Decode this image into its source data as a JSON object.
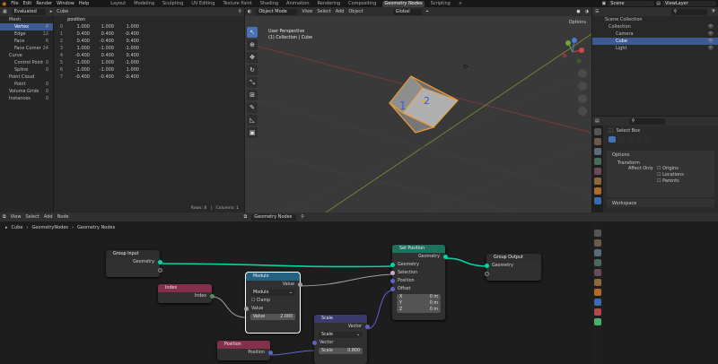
{
  "topbar": {
    "menus": [
      "File",
      "Edit",
      "Render",
      "Window",
      "Help"
    ],
    "workspaces": [
      "Layout",
      "Modeling",
      "Sculpting",
      "UV Editing",
      "Texture Paint",
      "Shading",
      "Animation",
      "Rendering",
      "Compositing",
      "Geometry Nodes",
      "Scripting"
    ],
    "active_workspace": "Geometry Nodes",
    "scene": "Scene",
    "view_layer": "ViewLayer"
  },
  "spreadsheet": {
    "mode": "Evaluated",
    "object": "Cube",
    "column_header": "position",
    "domains": [
      {
        "label": "Mesh",
        "level": 0
      },
      {
        "label": "Vertex",
        "level": 1,
        "count": "8",
        "selected": true
      },
      {
        "label": "Edge",
        "level": 1,
        "count": "12"
      },
      {
        "label": "Face",
        "level": 1,
        "count": "6"
      },
      {
        "label": "Face Corner",
        "level": 1,
        "count": "24"
      },
      {
        "label": "Curve",
        "level": 0
      },
      {
        "label": "Control Point",
        "level": 1,
        "count": "0"
      },
      {
        "label": "Spline",
        "level": 1,
        "count": "0"
      },
      {
        "label": "Point Cloud",
        "level": 0
      },
      {
        "label": "Point",
        "level": 1,
        "count": "0"
      },
      {
        "label": "Volume Grids",
        "level": 0,
        "count": "0"
      },
      {
        "label": "Instances",
        "level": 0,
        "count": "0"
      }
    ],
    "rows": [
      [
        "0",
        "1.000",
        "1.000",
        "1.000"
      ],
      [
        "1",
        "0.400",
        "0.400",
        "-0.400"
      ],
      [
        "2",
        "0.400",
        "-0.400",
        "0.400"
      ],
      [
        "3",
        "1.000",
        "-1.000",
        "-1.000"
      ],
      [
        "4",
        "-0.400",
        "0.400",
        "0.400"
      ],
      [
        "5",
        "-1.000",
        "1.000",
        "-1.000"
      ],
      [
        "6",
        "-1.000",
        "-1.000",
        "1.000"
      ],
      [
        "7",
        "-0.400",
        "-0.400",
        "-0.400"
      ]
    ],
    "footer_rows": "Rows: 8",
    "footer_cols": "Columns: 1"
  },
  "viewport": {
    "mode": "Object Mode",
    "menus": [
      "View",
      "Select",
      "Add",
      "Object"
    ],
    "transform": "Global",
    "info_line1": "User Perspective",
    "info_line2": "(1) Collection | Cube",
    "options": "Options"
  },
  "outliner": {
    "root": "Scene Collection",
    "items": [
      {
        "label": "Collection",
        "level": 1
      },
      {
        "label": "Camera",
        "level": 2
      },
      {
        "label": "Cube",
        "level": 2,
        "selected": true
      },
      {
        "label": "Light",
        "level": 2
      }
    ]
  },
  "properties": {
    "tool": "Select Box",
    "options": "Options",
    "transform": "Transform",
    "affect_only": "Affect Only",
    "checks": [
      "Origins",
      "Locations",
      "Parents"
    ],
    "workspace": "Workspace"
  },
  "node_editor": {
    "menus": [
      "View",
      "Select",
      "Add",
      "Node"
    ],
    "tree_name": "Geometry Nodes",
    "breadcrumb": [
      "Cube",
      "GeometryNodes",
      "Geometry Nodes"
    ],
    "nodes": {
      "group_input": {
        "title": "Group Input",
        "out": "Geometry"
      },
      "index": {
        "title": "Index",
        "out": "Index"
      },
      "modulo": {
        "title": "Modulo",
        "out": "Value",
        "op": "Modulo",
        "clamp": "Clamp",
        "in": "Value",
        "field_label": "Value",
        "field_value": "2.000"
      },
      "position": {
        "title": "Position",
        "out": "Position"
      },
      "scale": {
        "title": "Scale",
        "out": "Vector",
        "op": "Scale",
        "in": "Vector",
        "field_label": "Scale",
        "field_value": "0.800"
      },
      "set_position": {
        "title": "Set Position",
        "out": "Geometry",
        "inputs": [
          "Geometry",
          "Selection",
          "Position",
          "Offset"
        ],
        "x_label": "X",
        "x_val": "0 m",
        "y_label": "Y",
        "y_val": "0 m",
        "z_label": "Z",
        "z_val": "0 m"
      },
      "group_output": {
        "title": "Group Output",
        "in": "Geometry"
      }
    }
  },
  "colors": {
    "accent": "#4772b3",
    "geometry_socket": "#00d6a3",
    "vector_socket": "#6363c7",
    "header_input": "#83314a",
    "header_vector": "#3b3a6d",
    "header_geometry": "#1d725e",
    "header_converter": "#246283"
  }
}
